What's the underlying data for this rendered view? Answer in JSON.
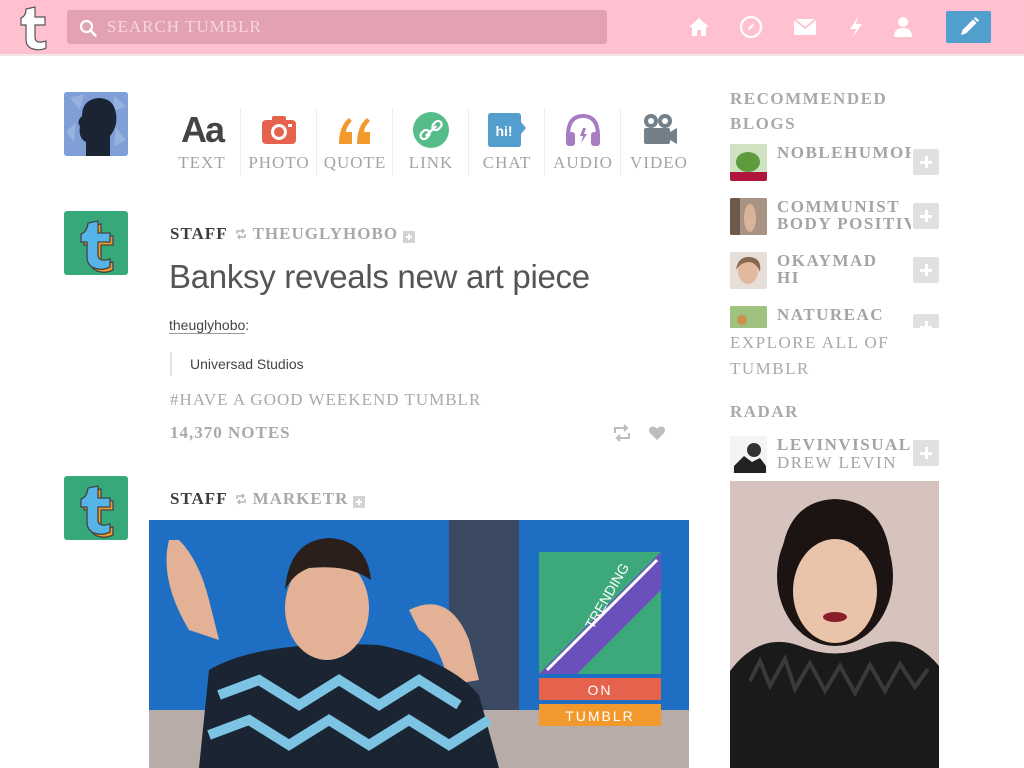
{
  "header": {
    "search_placeholder": "SEARCH TUMBLR",
    "brand_color": "#ffc1cf",
    "compose_color": "#529ecc",
    "nav_icons": [
      "home-icon",
      "explore-compass-icon",
      "inbox-mail-icon",
      "activity-lightning-icon",
      "account-person-icon"
    ]
  },
  "post_types": [
    {
      "label": "TEXT",
      "icon": "text-aa-icon",
      "color": "#444444"
    },
    {
      "label": "PHOTO",
      "icon": "camera-icon",
      "color": "#e5624d"
    },
    {
      "label": "QUOTE",
      "icon": "quote-icon",
      "color": "#f2992e"
    },
    {
      "label": "LINK",
      "icon": "link-icon",
      "color": "#56bc8a"
    },
    {
      "label": "CHAT",
      "icon": "chat-bubble-icon",
      "color": "#529ecc"
    },
    {
      "label": "AUDIO",
      "icon": "headphones-icon",
      "color": "#a77dc2"
    },
    {
      "label": "VIDEO",
      "icon": "video-camera-icon",
      "color": "#748089"
    }
  ],
  "posts": [
    {
      "blog": "STAFF",
      "reblogged_from": "THEUGLYHOBO",
      "title": "Banksy reveals new art piece",
      "reblog_user": "theuglyhobo",
      "quote": "Universad Studios",
      "tags": "#HAVE A GOOD WEEKEND TUMBLR",
      "notes": "14,370 NOTES"
    },
    {
      "blog": "STAFF",
      "reblogged_from": "MARKETR",
      "gif_caption": "",
      "trending_on": "ON",
      "trending_tumblr": "TUMBLR",
      "trending_word": "TRENDING"
    }
  ],
  "sidebar": {
    "recommended_title_1": "RECOMMENDED",
    "recommended_title_2": "BLOGS",
    "recommended": [
      {
        "name": "NOBLEHUMOR",
        "name2": ""
      },
      {
        "name": "COMMUNIST",
        "name2": "BODY POSITIVE"
      },
      {
        "name": "OKAYMAD",
        "name2": "HI"
      },
      {
        "name": "NATUREAC",
        "name2": ""
      }
    ],
    "explore_1": "EXPLORE ALL OF",
    "explore_2": "TUMBLR",
    "radar_title": "RADAR",
    "radar": {
      "name": "LEVINVISUAL",
      "sub": "DREW LEVIN"
    }
  }
}
